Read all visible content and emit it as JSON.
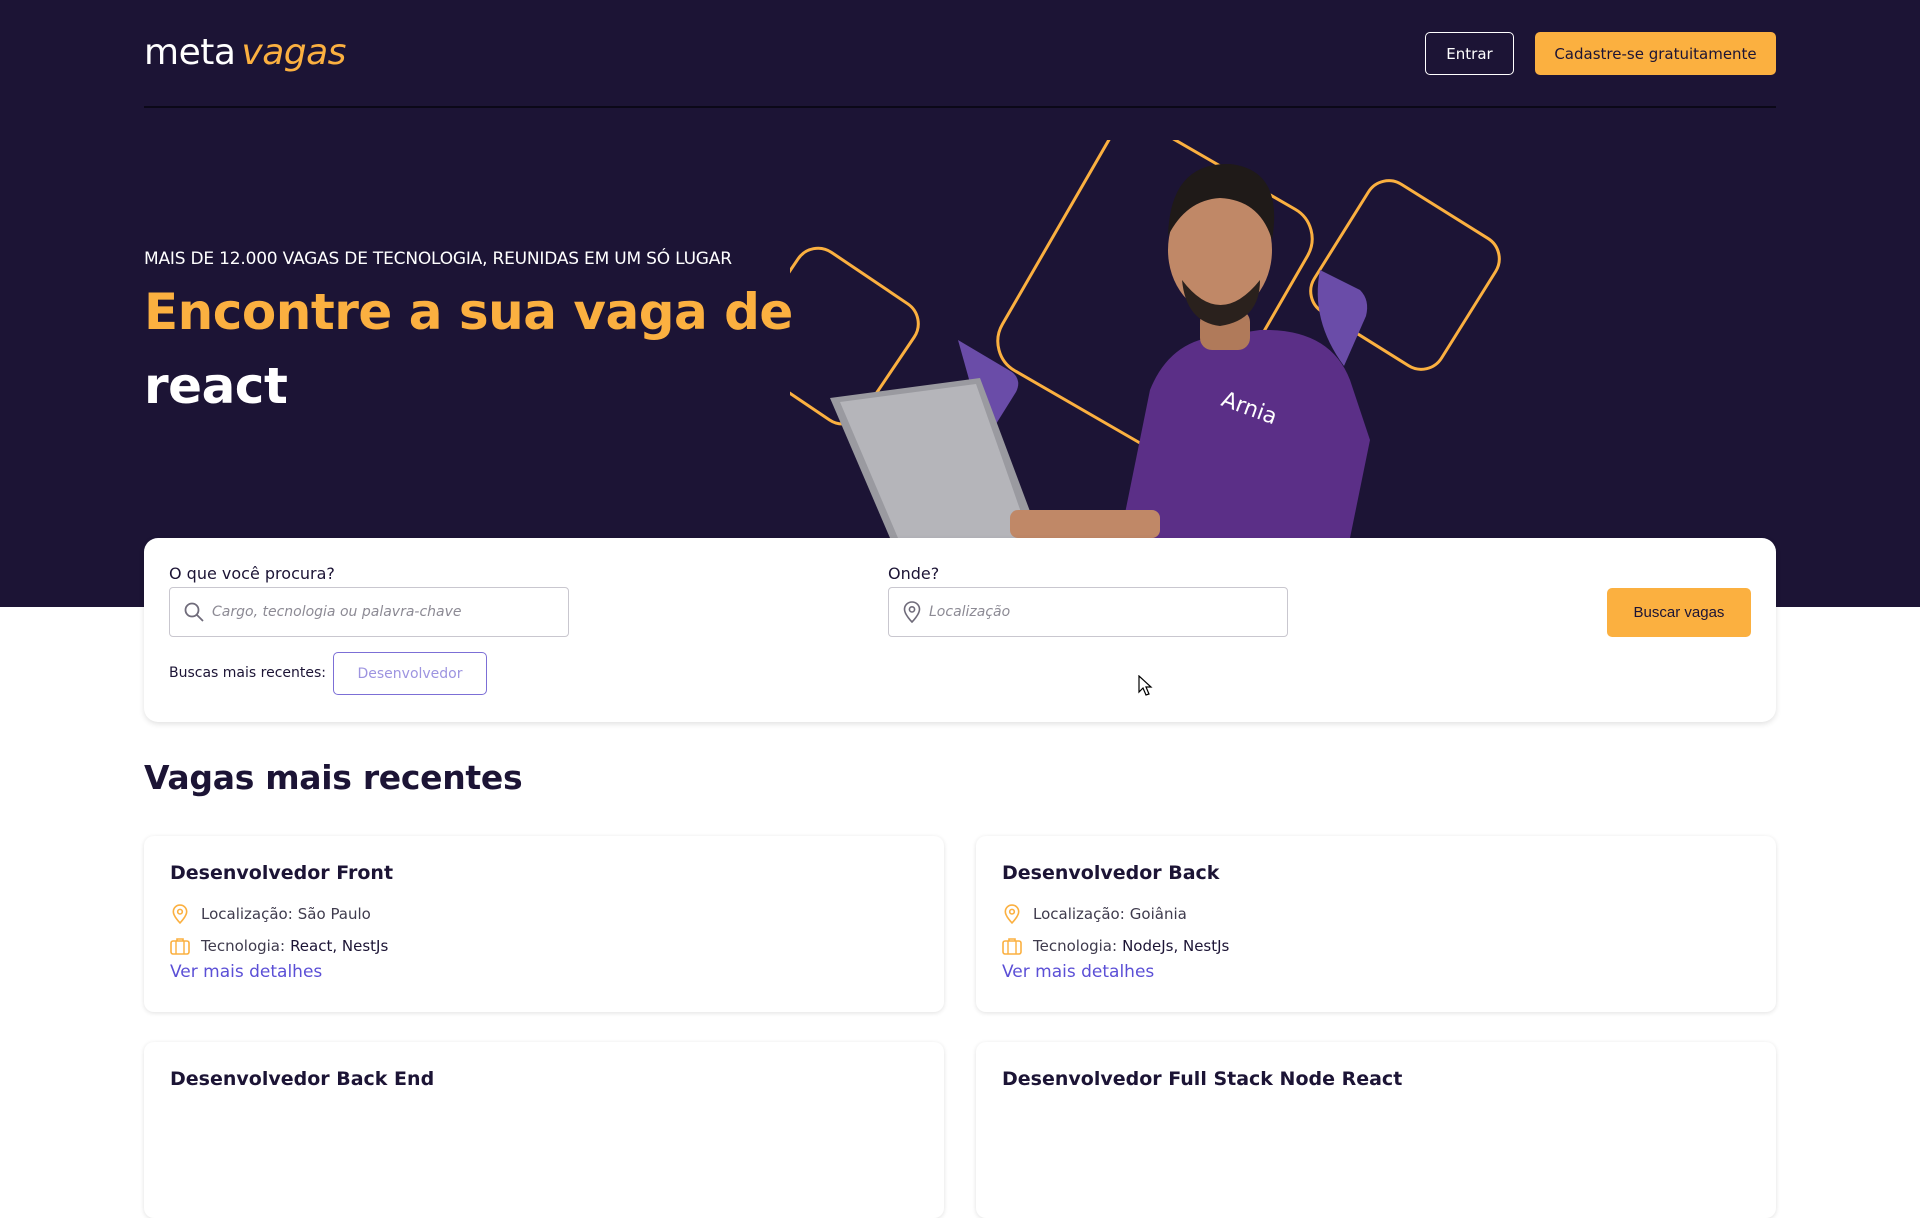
{
  "header": {
    "logo": {
      "part1": "meta",
      "part2": "vagas"
    },
    "login_label": "Entrar",
    "signup_label": "Cadastre-se gratuitamente"
  },
  "hero": {
    "eyebrow": "MAIS DE 12.000 VAGAS DE TECNOLOGIA, REUNIDAS EM UM SÓ LUGAR",
    "title": "Encontre a sua vaga de",
    "keyword": "react"
  },
  "search": {
    "what_label": "O que você procura?",
    "what_placeholder": "Cargo, tecnologia ou palavra-chave",
    "where_label": "Onde?",
    "where_placeholder": "Localização",
    "button_label": "Buscar vagas",
    "recent_label": "Buscas mais recentes:",
    "recent_items": [
      "Desenvolvedor"
    ]
  },
  "jobs": {
    "section_title": "Vagas mais recentes",
    "items": [
      {
        "title": "Desenvolvedor Front",
        "location_label": "Localização:",
        "location": "São Paulo",
        "tech_label": "Tecnologia:",
        "tech": "React, NestJs",
        "link": "Ver mais detalhes"
      },
      {
        "title": "Desenvolvedor Back",
        "location_label": "Localização:",
        "location": "Goiânia",
        "tech_label": "Tecnologia:",
        "tech": "NodeJs, NestJs",
        "link": "Ver mais detalhes"
      },
      {
        "title": "Desenvolvedor Back End"
      },
      {
        "title": "Desenvolvedor Full Stack Node React"
      }
    ]
  },
  "colors": {
    "navy": "#1c1435",
    "accent": "#fbb040",
    "purple": "#6a4ca8",
    "link": "#5b4fd6"
  },
  "icons": [
    "search-icon",
    "location-pin-icon",
    "briefcase-icon",
    "mouse-cursor-icon"
  ]
}
